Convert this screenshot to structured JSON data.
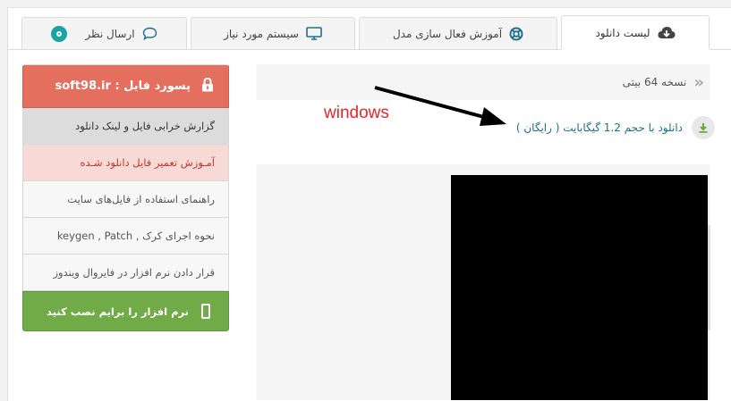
{
  "tabs": [
    {
      "label": "لیست دانلود",
      "icon": "cloud-download-icon",
      "active": true
    },
    {
      "label": "آموزش فعال سازی مدل",
      "icon": "lifebuoy-icon",
      "active": false
    },
    {
      "label": "سیستم مورد نیاز",
      "icon": "monitor-icon",
      "active": false
    },
    {
      "label": "ارسال نظر",
      "icon": "comment-icon",
      "badge_icon": "teal-dot-icon",
      "active": false
    }
  ],
  "sidebar": {
    "password_label": "پسورد فایل : soft98.ir",
    "password_icon": "lock-icon",
    "items": [
      {
        "label": "گزارش خرابی فایل و لینک دانلود"
      },
      {
        "label": "آمـوزش تعمیر فایل دانلود شـده"
      },
      {
        "label": "راهنمای استفاده از فایل‌های سایت"
      },
      {
        "label": "نحوه اجرای کرک , keygen , Patch"
      },
      {
        "label": "قرار دادن نرم افزار در فایروال ویندوز"
      }
    ],
    "install_label": "نرم افزار را برایم نصب کنید",
    "install_icon": "phone-icon"
  },
  "main": {
    "version_label": "نسخه 64 بیتی",
    "version_icon": "double-chevron-left-icon",
    "download_link": "دانلود با حجم 1.2 گیگابایت ( رایگان )",
    "download_icon": "download-arrow-icon"
  },
  "annotation": {
    "text": "windows",
    "color": "#e8262a"
  },
  "colors": {
    "password_bg": "#e46f5f",
    "install_bg": "#71ab48",
    "link": "#1f6e8c",
    "badge": "#19a3a3"
  }
}
